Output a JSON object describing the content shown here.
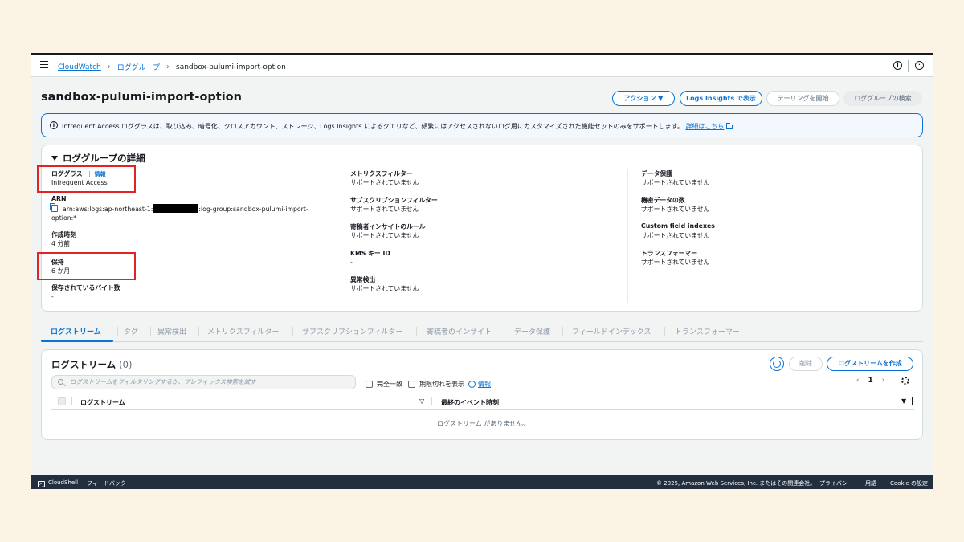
{
  "topbar": {
    "breadcrumb": [
      "CloudWatch",
      "ロググループ",
      "sandbox-pulumi-import-option"
    ]
  },
  "header": {
    "title": "sandbox-pulumi-import-option",
    "actions_label": "アクション",
    "logs_insights_label": "Logs Insights で表示",
    "tailing_label": "テーリングを開始",
    "search_label": "ロググループの検索"
  },
  "banner": {
    "text": "Infrequent Access ロググラスは、取り込み、暗号化、クロスアカウント、ストレージ、Logs Insights によるクエリなど、頻繁にはアクセスされないログ用にカスタマイズされた機能セットのみをサポートします。",
    "link": "詳細はこちら"
  },
  "details": {
    "title": "ロググループの詳細",
    "info_link": "情報",
    "col1": [
      {
        "label": "ロググラス",
        "value": "Infrequent Access"
      },
      {
        "label": "ARN",
        "value_prefix": "arn:aws:logs:ap-northeast-1:",
        "value_suffix": ":log-group:sandbox-pulumi-import-",
        "value_line2": "option:*"
      },
      {
        "label": "作成時刻",
        "value": "4 分前"
      },
      {
        "label": "保持",
        "value": "6 か月"
      },
      {
        "label": "保存されているバイト数",
        "value": "-"
      }
    ],
    "col2": [
      {
        "label": "メトリクスフィルター",
        "value": "サポートされていません"
      },
      {
        "label": "サブスクリプションフィルター",
        "value": "サポートされていません"
      },
      {
        "label": "寄稿者インサイトのルール",
        "value": "サポートされていません"
      },
      {
        "label": "KMS キー ID",
        "value": "-"
      },
      {
        "label": "異常検出",
        "value": "サポートされていません"
      }
    ],
    "col3": [
      {
        "label": "データ保護",
        "value": "サポートされていません"
      },
      {
        "label": "機密データの数",
        "value": "サポートされていません"
      },
      {
        "label": "Custom field indexes",
        "value": "サポートされていません"
      },
      {
        "label": "トランスフォーマー",
        "value": "サポートされていません"
      }
    ]
  },
  "tabs": [
    "ログストリーム",
    "タグ",
    "異常検出",
    "メトリクスフィルター",
    "サブスクリプションフィルター",
    "寄稿者のインサイト",
    "データ保護",
    "フィールドインデックス",
    "トランスフォーマー"
  ],
  "streams": {
    "title": "ログストリーム",
    "count": "(0)",
    "delete_label": "削除",
    "create_label": "ログストリームを作成",
    "search_placeholder": "ログストリームをフィルタリングするか、プレフィックス検索を試す",
    "exact_match_label": "完全一致",
    "show_expired_label": "期限切れを表示",
    "info_label": "情報",
    "page_number": "1",
    "col_stream": "ログストリーム",
    "col_last_event": "最終のイベント時刻",
    "empty_text": "ログストリーム がありません。"
  },
  "footer": {
    "cloudshell": "CloudShell",
    "feedback": "フィードバック",
    "copyright": "© 2025, Amazon Web Services, Inc. またはその関連会社。",
    "privacy": "プライバシー",
    "terms": "用語",
    "cookie": "Cookie の設定"
  },
  "colors": {
    "accent": "#0972d3",
    "highlight": "#e02424",
    "footer_bg": "#232f3e"
  }
}
